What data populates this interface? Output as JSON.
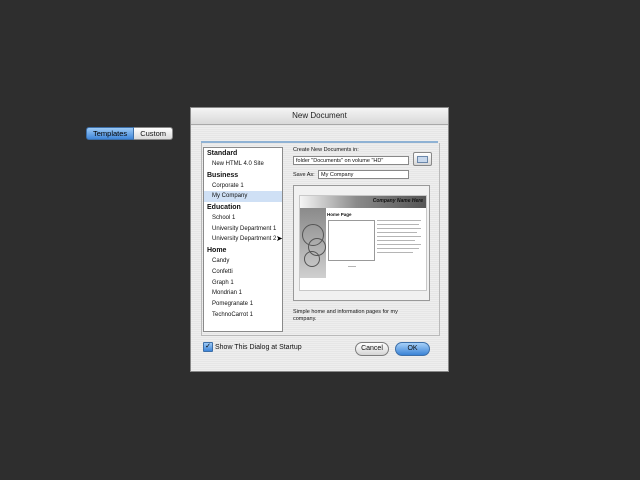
{
  "dialog": {
    "title": "New Document",
    "tabs": [
      {
        "label": "Templates",
        "selected": true
      },
      {
        "label": "Custom",
        "selected": false
      }
    ]
  },
  "templates": {
    "categories": [
      {
        "name": "Standard",
        "items": [
          "New HTML 4.0 Site"
        ]
      },
      {
        "name": "Business",
        "items": [
          "Corporate 1",
          "My Company"
        ]
      },
      {
        "name": "Education",
        "items": [
          "School 1",
          "University Department 1",
          "University Department 2"
        ]
      },
      {
        "name": "Home",
        "items": [
          "Candy",
          "Confetti",
          "Graph 1",
          "Mondrian 1",
          "Pomegranate 1",
          "TechnoCarrot 1"
        ]
      }
    ],
    "selected": "My Company"
  },
  "location": {
    "label": "Create New Documents in:",
    "folder_value": "folder \"Documents\" on volume \"HD\"",
    "folder_button_icon": "folder-icon"
  },
  "save_as": {
    "label": "Save As:",
    "value": "My Company"
  },
  "preview": {
    "banner_title": "Company Name Here",
    "page_heading": "Home Page"
  },
  "description": "Simple home and information pages for my company.",
  "footer": {
    "show_at_startup_label": "Show This Dialog at Startup",
    "show_at_startup_checked": true,
    "cancel_label": "Cancel",
    "ok_label": "OK"
  },
  "colors": {
    "accent": "#3f86d9",
    "selection": "#cfe0f5"
  }
}
